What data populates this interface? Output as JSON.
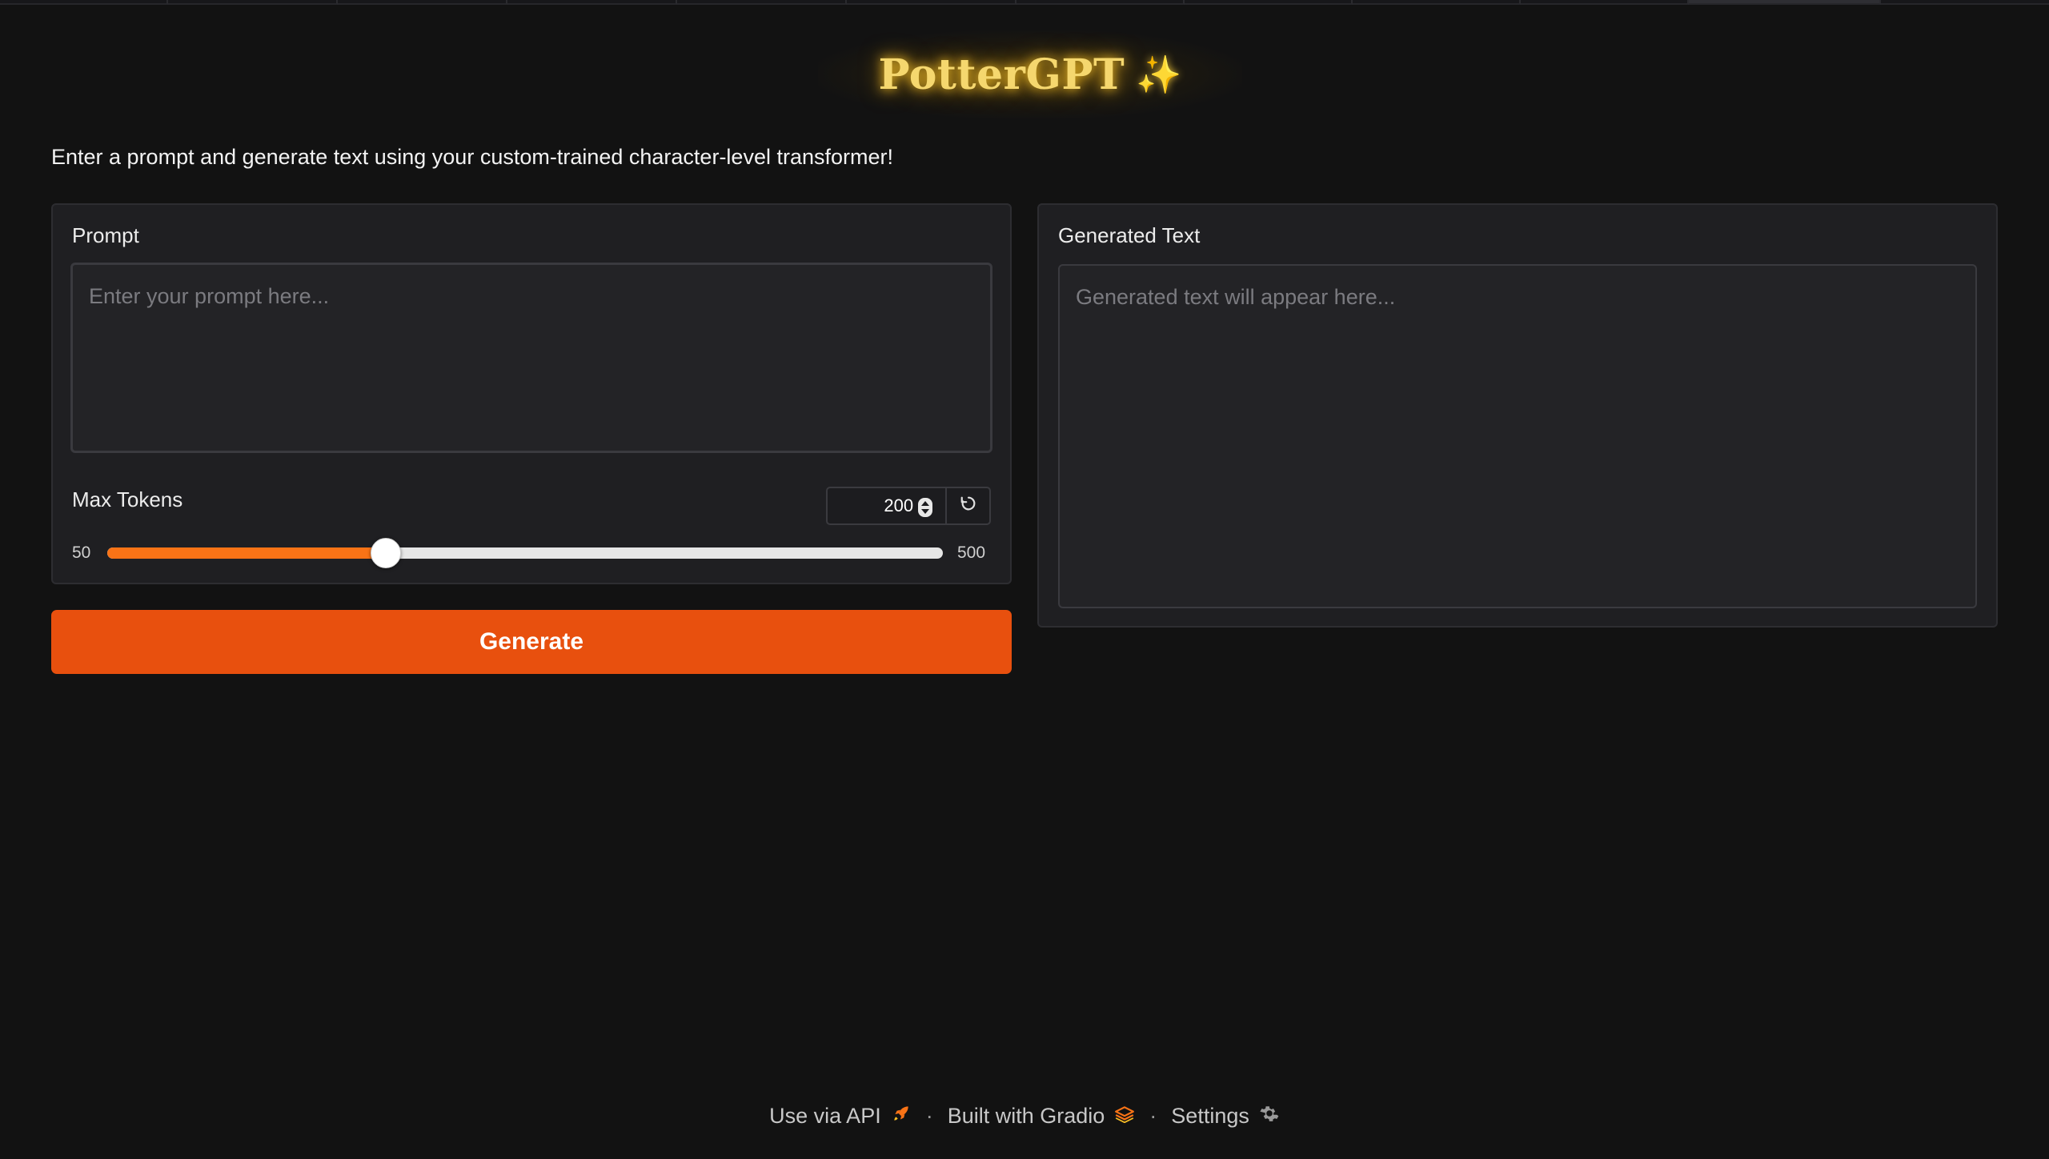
{
  "app": {
    "title": "PotterGPT",
    "title_sparkle": "✨",
    "description": "Enter a prompt and generate text using your custom-trained character-level transformer!"
  },
  "input_panel": {
    "prompt_label": "Prompt",
    "prompt_placeholder": "Enter your prompt here...",
    "prompt_value": "",
    "max_tokens": {
      "label": "Max Tokens",
      "value": "200",
      "min": "50",
      "max": "500",
      "fraction": 0.3333
    },
    "generate_label": "Generate"
  },
  "output_panel": {
    "label": "Generated Text",
    "placeholder": "Generated text will appear here...",
    "value": ""
  },
  "footer": {
    "api_label": "Use via API",
    "api_icon": "rocket-icon",
    "built_label": "Built with Gradio",
    "built_icon": "gradio-logo-icon",
    "settings_label": "Settings",
    "settings_icon": "gear-icon",
    "separator": "·"
  },
  "colors": {
    "accent": "#e8500e",
    "slider_fill": "#f97316",
    "title_gold": "#f5d76e",
    "background": "#121212",
    "panel": "#1f1f22"
  }
}
